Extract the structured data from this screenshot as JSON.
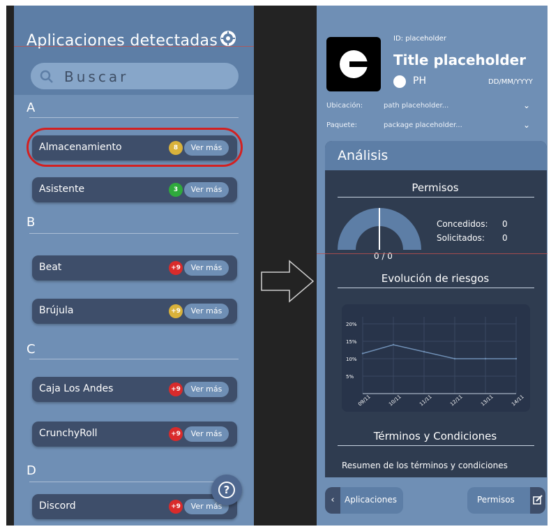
{
  "left": {
    "title": "Aplicaciones detectadas",
    "search_placeholder": "Buscar",
    "sections": [
      {
        "letter": "A",
        "apps": [
          {
            "name": "Almacenamiento",
            "badge": "8",
            "badge_color": "#d9b23b",
            "action": "Ver más"
          },
          {
            "name": "Asistente",
            "badge": "3",
            "badge_color": "#2faa3c",
            "action": "Ver más"
          }
        ]
      },
      {
        "letter": "B",
        "apps": [
          {
            "name": "Beat",
            "badge": "+9",
            "badge_color": "#d92b2b",
            "action": "Ver más"
          },
          {
            "name": "Brújula",
            "badge": "+9",
            "badge_color": "#d9b23b",
            "action": "Ver más"
          }
        ]
      },
      {
        "letter": "C",
        "apps": [
          {
            "name": "Caja Los Andes",
            "badge": "+9",
            "badge_color": "#d92b2b",
            "action": "Ver más"
          },
          {
            "name": "CrunchyRoll",
            "badge": "+9",
            "badge_color": "#d92b2b",
            "action": "Ver más"
          }
        ]
      },
      {
        "letter": "D",
        "apps": [
          {
            "name": "Discord",
            "badge": "+9",
            "badge_color": "#d92b2b",
            "action": "Ver más"
          }
        ]
      }
    ],
    "help_icon": "question-circle-icon",
    "settings_icon": "gear-icon"
  },
  "right": {
    "app_id": "ID: placeholder",
    "app_title": "Title placeholder",
    "ph_label": "PH",
    "date": "DD/MM/YYYY",
    "location_key": "Ubicación:",
    "location_value": "path placeholder...",
    "package_key": "Paquete:",
    "package_value": "package placeholder...",
    "analysis": {
      "title": "Análisis",
      "permissions_title": "Permisos",
      "gauge_value": "0 / 0",
      "granted_label": "Concedidos:",
      "granted_value": "0",
      "requested_label": "Solicitados:",
      "requested_value": "0",
      "risk_title": "Evolución de riesgos",
      "terms_title": "Términos y Condiciones",
      "terms_text": "Resumen de los términos y condiciones"
    },
    "apps_button": "Aplicaciones",
    "permissions_button": "Permisos"
  },
  "chart_data": {
    "type": "line",
    "categories": [
      "09/11",
      "10/11",
      "11/11",
      "12/11",
      "13/11",
      "14/11"
    ],
    "yticks": [
      "5%",
      "10%",
      "15%",
      "20%"
    ],
    "ylim": [
      0,
      22
    ],
    "series": [
      {
        "values": [
          11.5,
          14,
          12,
          10,
          10,
          10
        ]
      }
    ],
    "grid": true
  },
  "colors": {
    "panel": "#6f8fb5",
    "header": "#5d7ea6",
    "row": "#3e4e6a",
    "card": "#2f3c50"
  }
}
